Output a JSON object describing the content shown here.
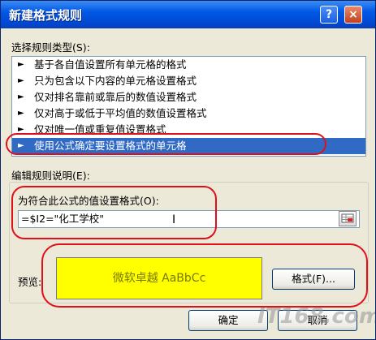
{
  "window": {
    "title": "新建格式规则",
    "help_symbol": "?",
    "close_symbol": "×"
  },
  "rule_type": {
    "label": "选择规则类型(S):",
    "items": [
      {
        "arrow": "►",
        "text": "基于各自值设置所有单元格的格式"
      },
      {
        "arrow": "►",
        "text": "只为包含以下内容的单元格设置格式"
      },
      {
        "arrow": "►",
        "text": "仅对排名靠前或靠后的数值设置格式"
      },
      {
        "arrow": "►",
        "text": "仅对高于或低于平均值的数值设置格式"
      },
      {
        "arrow": "►",
        "text": "仅对唯一值或重复值设置格式"
      },
      {
        "arrow": "►",
        "text": "使用公式确定要设置格式的单元格"
      }
    ],
    "selected_index": 5
  },
  "rule_description": {
    "label": "编辑规则说明(E):",
    "formula_label": "为符合此公式的值设置格式(O):",
    "formula_value": "=$I2=\"化工学校\"",
    "cursor_glyph": "I"
  },
  "preview": {
    "label": "预览:",
    "sample_text": "微软卓越  AaBbCc",
    "background_color": "#ffff00",
    "format_button": "格式(F)..."
  },
  "buttons": {
    "ok": "确定",
    "cancel": "取消"
  },
  "watermark": "IT168.com",
  "colors": {
    "title_bar": "#0058e6",
    "selection": "#316ac5",
    "highlight_ring": "#e0101a"
  }
}
